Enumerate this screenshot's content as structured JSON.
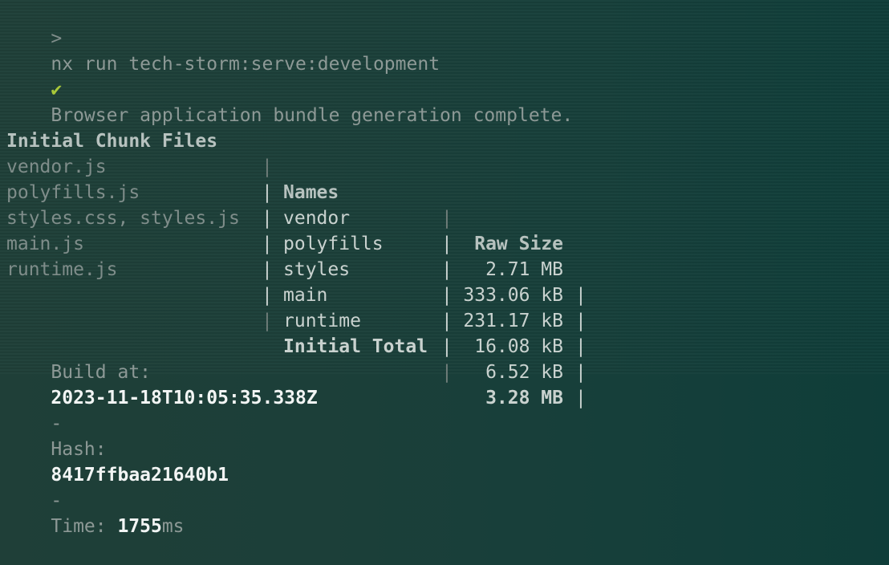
{
  "command": {
    "prompt": ">",
    "text": "nx run tech-storm:serve:development"
  },
  "status": {
    "icon": "✔",
    "message": "Browser application bundle generation complete."
  },
  "table": {
    "headers": {
      "files": "Initial Chunk Files",
      "names": "Names",
      "raw_size": "Raw Size"
    },
    "rows": [
      {
        "file": "vendor.js",
        "name": "vendor",
        "size": "2.71 MB"
      },
      {
        "file": "polyfills.js",
        "name": "polyfills",
        "size": "333.06 kB"
      },
      {
        "file": "styles.css, styles.js",
        "name": "styles",
        "size": "231.17 kB"
      },
      {
        "file": "main.js",
        "name": "main",
        "size": "16.08 kB"
      },
      {
        "file": "runtime.js",
        "name": "runtime",
        "size": "6.52 kB"
      }
    ],
    "total": {
      "label": "Initial Total",
      "size": "3.28 MB"
    },
    "separator": "|"
  },
  "build": {
    "build_at_label": "Build at:",
    "build_at_value": "2023-11-18T10:05:35.338Z",
    "dash1": "-",
    "hash_label": "Hash:",
    "hash_value": "8417ffbaa21640b1",
    "dash2": "-",
    "time_label": "Time:",
    "time_value": "1755",
    "time_unit": "ms"
  }
}
